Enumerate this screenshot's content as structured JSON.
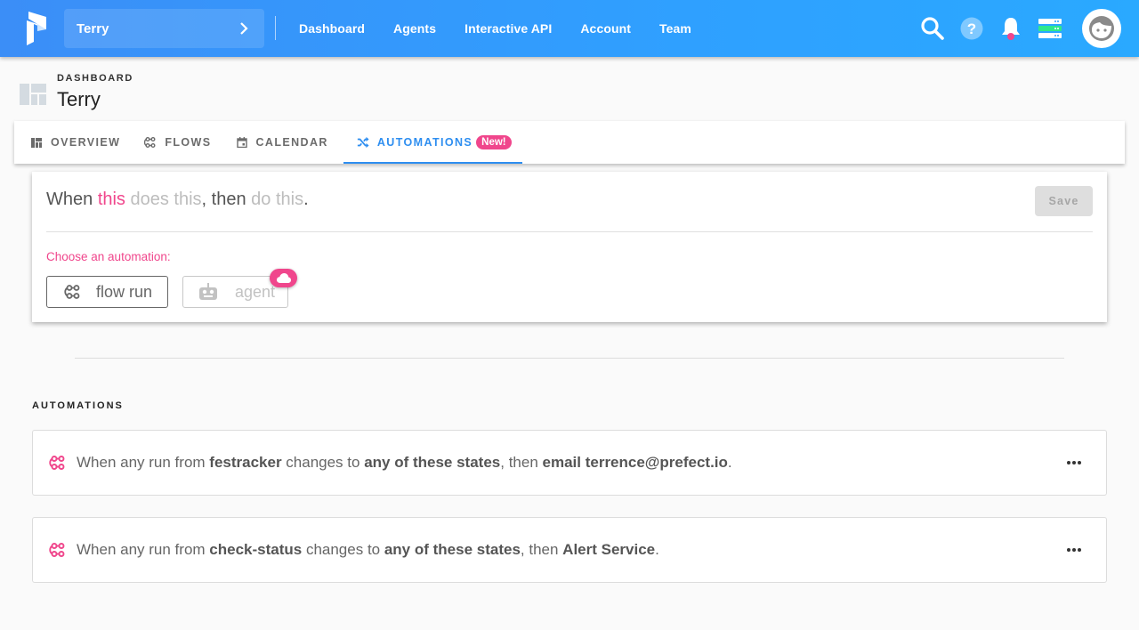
{
  "topbar": {
    "team_name": "Terry",
    "nav": [
      "Dashboard",
      "Agents",
      "Interactive API",
      "Account",
      "Team"
    ],
    "icons": [
      "search-icon",
      "help-icon",
      "notifications-bell-icon",
      "server-status-icon",
      "user-avatar"
    ]
  },
  "header": {
    "breadcrumb": "DASHBOARD",
    "title": "Terry"
  },
  "tabs": [
    {
      "label": "OVERVIEW",
      "icon": "overview-icon",
      "active": false
    },
    {
      "label": "FLOWS",
      "icon": "flows-icon",
      "active": false
    },
    {
      "label": "CALENDAR",
      "icon": "calendar-icon",
      "active": false
    },
    {
      "label": "AUTOMATIONS",
      "icon": "shuffle-icon",
      "active": true,
      "badge": "New!"
    }
  ],
  "builder": {
    "sentence": {
      "w1": "When ",
      "w2": "this",
      "w3": " does this",
      "w4": ", then ",
      "w5": "do this",
      "w6": "."
    },
    "save_label": "Save",
    "choose_label": "Choose an automation:",
    "options": [
      {
        "label": "flow run",
        "icon": "flow-icon",
        "enabled": true
      },
      {
        "label": "agent",
        "icon": "robot-icon",
        "enabled": false,
        "badge_icon": "cloud-icon"
      }
    ]
  },
  "automations": {
    "section_label": "AUTOMATIONS",
    "items": [
      {
        "p1": "When any run from ",
        "flow": "festracker",
        "p2": " changes to ",
        "states": "any of these states",
        "p3": ", then ",
        "action": "email terrence@prefect.io",
        "p4": "."
      },
      {
        "p1": "When any run from ",
        "flow": "check-status",
        "p2": " changes to ",
        "states": "any of these states",
        "p3": ", then ",
        "action": "Alert Service",
        "p4": "."
      }
    ]
  },
  "colors": {
    "brand_blue": "#2e8ef0",
    "accent_pink": "#f0468c",
    "status_green": "#2ee88c"
  }
}
